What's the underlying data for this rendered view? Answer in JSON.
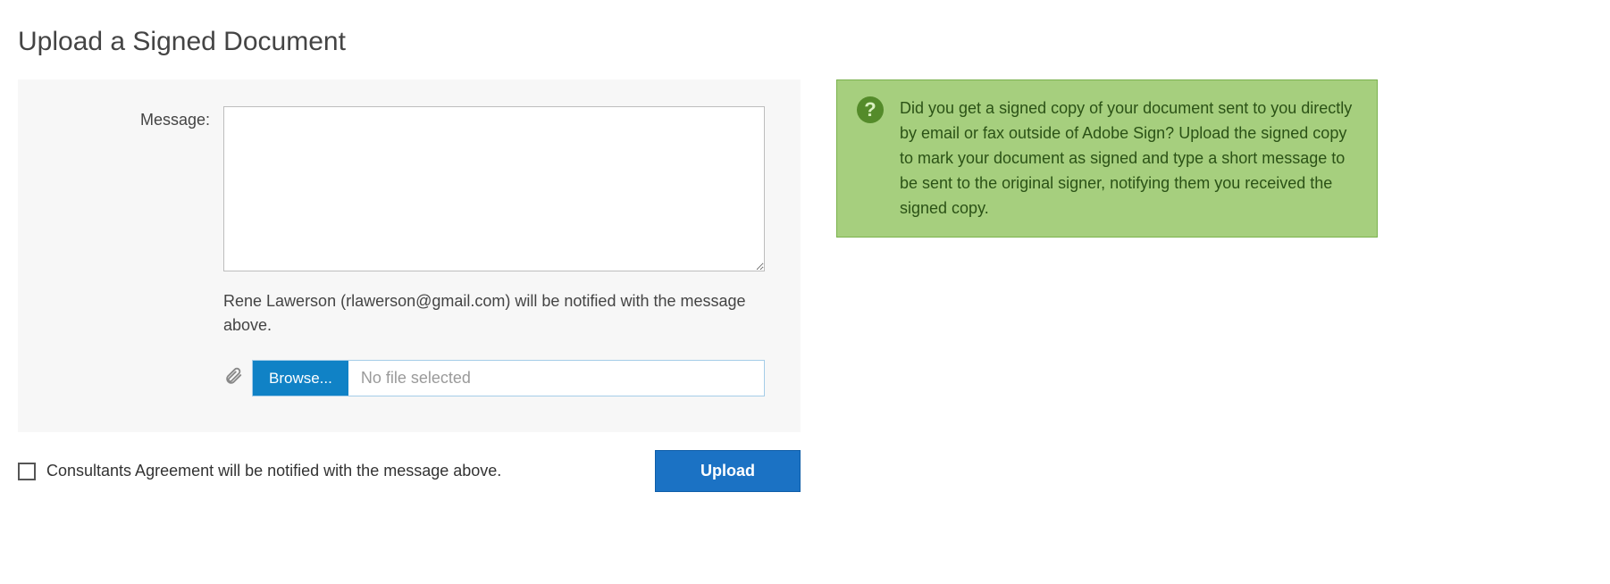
{
  "title": "Upload a Signed Document",
  "form": {
    "message_label": "Message:",
    "message_value": "",
    "notify_text": "Rene Lawerson (rlawerson@gmail.com) will be notified with the message above.",
    "browse_label": "Browse...",
    "file_selected_text": "No file selected"
  },
  "footer": {
    "checkbox_label": "Consultants Agreement will be notified with the message above.",
    "upload_label": "Upload"
  },
  "help": {
    "icon_glyph": "?",
    "text": "Did you get a signed copy of your document sent to you directly by email or fax outside of Adobe Sign? Upload the signed copy to mark your document as signed and type a short message to be sent to the original signer, notifying them you received the signed copy."
  }
}
